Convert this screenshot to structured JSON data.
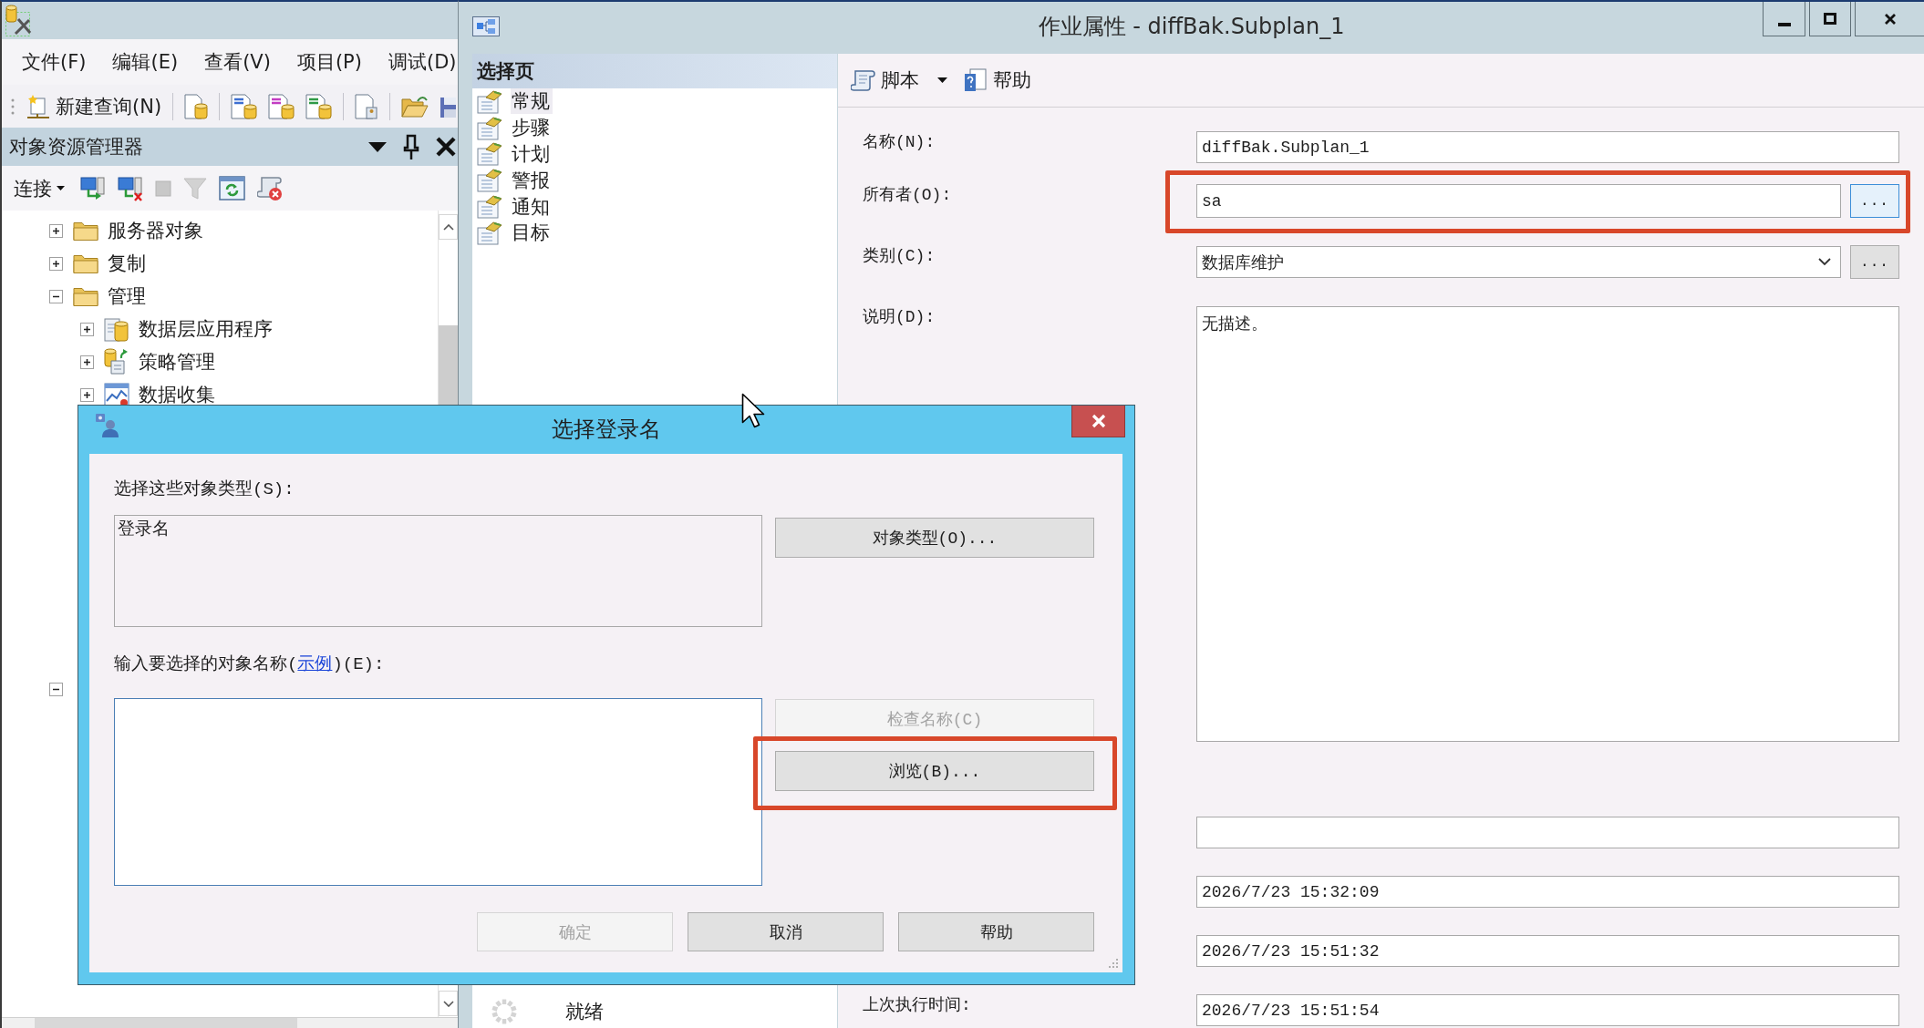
{
  "ssms": {
    "menu": [
      "文件(F)",
      "编辑(E)",
      "查看(V)",
      "项目(P)",
      "调试(D)"
    ],
    "toolbar": {
      "new_query": "新建查询(N)"
    },
    "object_explorer": {
      "title": "对象资源管理器",
      "connect": "连接",
      "tree": [
        {
          "label": "服务器对象",
          "kind": "folder",
          "expanded": false
        },
        {
          "label": "复制",
          "kind": "folder",
          "expanded": false
        },
        {
          "label": "管理",
          "kind": "folder",
          "expanded": true,
          "children": [
            {
              "label": "数据层应用程序",
              "kind": "data-tier",
              "expanded": false
            },
            {
              "label": "策略管理",
              "kind": "policy",
              "expanded": false
            },
            {
              "label": "数据收集",
              "kind": "data-collection",
              "expanded": false
            }
          ]
        },
        {
          "expanded": true
        }
      ]
    }
  },
  "job_window": {
    "title": "作业属性 - diffBak.Subplan_1",
    "select_page": {
      "title": "选择页",
      "pages": [
        {
          "label": "常规",
          "selected": true
        },
        {
          "label": "步骤",
          "selected": false
        },
        {
          "label": "计划",
          "selected": false
        },
        {
          "label": "警报",
          "selected": false
        },
        {
          "label": "通知",
          "selected": false
        },
        {
          "label": "目标",
          "selected": false
        }
      ]
    },
    "toolbar": {
      "script": "脚本",
      "help": "帮助"
    },
    "fields": [
      {
        "label": "名称(N):",
        "kind": "text",
        "value": "diffBak.Subplan_1",
        "highlighted": false
      },
      {
        "label": "所有者(O):",
        "kind": "text",
        "value": "sa",
        "button": {
          "label": "...",
          "focused": true
        },
        "highlighted": true
      },
      {
        "label": "类别(C):",
        "kind": "dropdown",
        "value": "数据库维护",
        "button": {
          "label": "...",
          "focused": false
        },
        "highlighted": false
      },
      {
        "label": "说明(D):",
        "kind": "memo",
        "value": "无描述。",
        "highlighted": false
      },
      {
        "kind": "text",
        "highlighted": false
      },
      {
        "kind": "text",
        "value": "2026/7/23 15:32:09",
        "highlighted": false
      },
      {
        "kind": "text",
        "value": "2026/7/23 15:51:32",
        "highlighted": false
      },
      {
        "label": "上次执行时间:",
        "kind": "text",
        "value": "2026/7/23 15:51:54",
        "highlighted": false
      }
    ],
    "status": "就绪"
  },
  "dialog": {
    "title": "选择登录名",
    "object_types_label": "选择这些对象类型(S):",
    "object_types": "登录名",
    "object_types_button": "对象类型(O)...",
    "object_names_label": [
      {
        "kind": "text",
        "text": "输入要选择的对象名称("
      },
      {
        "kind": "link",
        "text": "示例"
      },
      {
        "kind": "text",
        "text": ")(E):"
      }
    ],
    "name_buttons": [
      {
        "label": "检查名称(C)",
        "disabled": true,
        "highlighted": false
      },
      {
        "label": "浏览(B)...",
        "disabled": false,
        "highlighted": true
      }
    ],
    "buttons": [
      {
        "label": "确定",
        "disabled": true
      },
      {
        "label": "取消",
        "disabled": false
      },
      {
        "label": "帮助",
        "disabled": false
      }
    ]
  }
}
